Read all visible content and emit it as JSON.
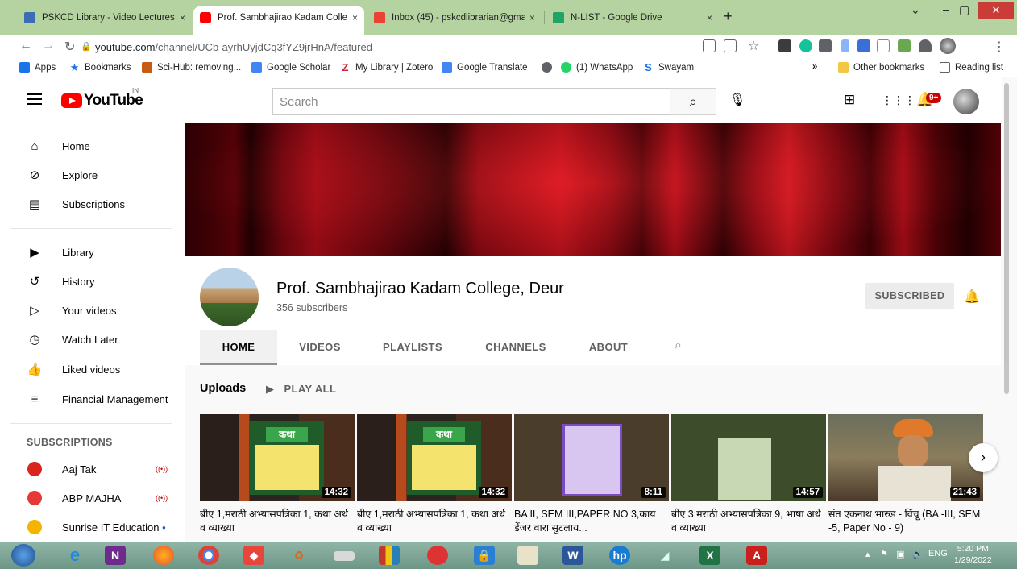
{
  "browser": {
    "tabs": [
      {
        "title": "PSKCD Library - Video Lectures",
        "favicon_color": "#3b6db5",
        "active": false
      },
      {
        "title": "Prof. Sambhajirao Kadam College",
        "favicon_color": "#ff0000",
        "active": true
      },
      {
        "title": "Inbox (45) - pskcdlibrarian@gma",
        "favicon_color": "#ea4335",
        "active": false
      },
      {
        "title": "N-LIST - Google Drive",
        "favicon_color": "#1fa463",
        "active": false
      }
    ],
    "tab_close": "×",
    "new_tab": "+",
    "window_controls": {
      "minimize": "–",
      "maximize": "▢",
      "close": "✕"
    },
    "url_host": "youtube.com",
    "url_path": "/channel/UCb-ayrhUyjdCq3fYZ9jrHnA/featured",
    "bookmarks": [
      {
        "label": "Apps",
        "icon": "apps-grid-icon",
        "color": "#1a73e8"
      },
      {
        "label": "Bookmarks",
        "icon": "star-icon",
        "color": "#1a73e8"
      },
      {
        "label": "Sci-Hub: removing...",
        "icon": "raven-icon",
        "color": "#c75b12"
      },
      {
        "label": "Google Scholar",
        "icon": "scholar-icon",
        "color": "#4285f4"
      },
      {
        "label": "My Library | Zotero",
        "icon": "zotero-icon",
        "color": "#cc2936"
      },
      {
        "label": "Google Translate",
        "icon": "translate-icon",
        "color": "#4285f4"
      },
      {
        "label": "",
        "icon": "globe-icon",
        "color": "#5f6368"
      },
      {
        "label": "(1) WhatsApp",
        "icon": "whatsapp-icon",
        "color": "#25d366"
      },
      {
        "label": "Swayam",
        "icon": "swayam-icon",
        "color": "#1a73e8"
      }
    ],
    "bookmarks_overflow": "»",
    "other_bookmarks": "Other bookmarks",
    "reading_list": "Reading list"
  },
  "youtube": {
    "logo_text": "YouTube",
    "country_code": "IN",
    "search_placeholder": "Search",
    "notification_count": "9+",
    "sidebar": {
      "main": [
        {
          "label": "Home",
          "icon": "home-icon"
        },
        {
          "label": "Explore",
          "icon": "compass-icon"
        },
        {
          "label": "Subscriptions",
          "icon": "subscriptions-icon"
        }
      ],
      "library": [
        {
          "label": "Library",
          "icon": "library-icon"
        },
        {
          "label": "History",
          "icon": "history-icon"
        },
        {
          "label": "Your videos",
          "icon": "your-videos-icon"
        },
        {
          "label": "Watch Later",
          "icon": "clock-icon"
        },
        {
          "label": "Liked videos",
          "icon": "thumbs-up-icon"
        },
        {
          "label": "Financial Management",
          "icon": "playlist-icon"
        }
      ],
      "subscriptions_heading": "SUBSCRIPTIONS",
      "subscriptions": [
        {
          "label": "Aaj Tak",
          "live": "((•))",
          "color": "#d9251d"
        },
        {
          "label": "ABP MAJHA",
          "live": "((•))",
          "color": "#e53935"
        },
        {
          "label": "Sunrise IT Education",
          "live": "•",
          "color": "#f4b400"
        }
      ]
    },
    "channel": {
      "name": "Prof. Sambhajirao Kadam College, Deur",
      "subscribers": "356 subscribers",
      "subscribe_button": "SUBSCRIBED",
      "tabs": [
        "HOME",
        "VIDEOS",
        "PLAYLISTS",
        "CHANNELS",
        "ABOUT"
      ],
      "uploads_label": "Uploads",
      "play_all": "PLAY ALL",
      "videos": [
        {
          "title": "बीए 1,मराठी अभ्यासपत्रिका 1, कथा अर्थ व व्याख्या",
          "duration": "14:32"
        },
        {
          "title": "बीए 1,मराठी अभ्यासपत्रिका 1, कथा अर्थ व व्याख्या",
          "duration": "14:32"
        },
        {
          "title": "BA II, SEM III,PAPER NO 3,काय डेंजर वारा सुटलाय...",
          "duration": "8:11"
        },
        {
          "title": "बीए 3 मराठी अभ्यासपत्रिका 9, भाषा अर्थ व व्याख्या",
          "duration": "14:57"
        },
        {
          "title": "संत एकनाथ भारुड - विंचू (BA -III, SEM -5, Paper No - 9)",
          "duration": "21:43"
        }
      ],
      "thumb_board_text": "कथा"
    }
  },
  "taskbar": {
    "language": "ENG",
    "time": "5:20 PM",
    "date": "1/29/2022"
  }
}
